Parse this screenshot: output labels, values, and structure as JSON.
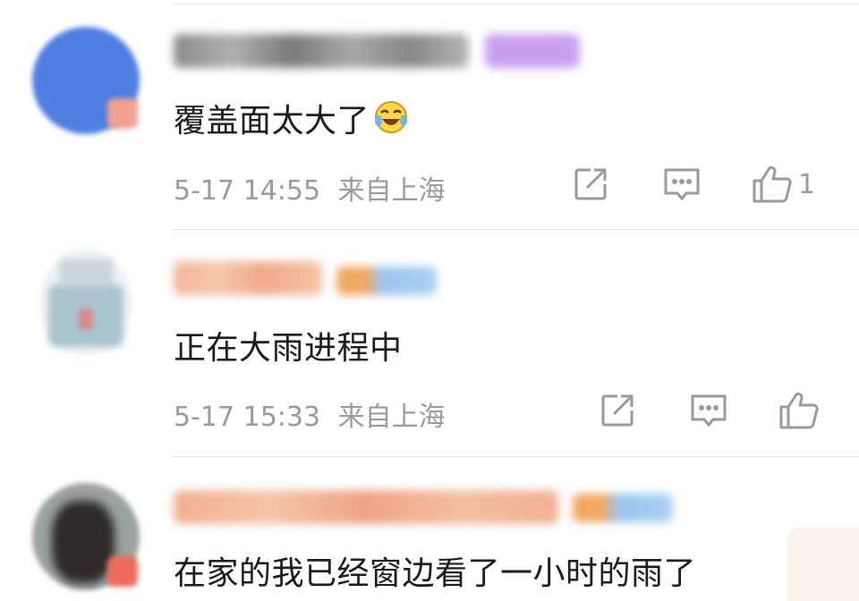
{
  "comments": [
    {
      "text": "覆盖面太大了",
      "emoji": "laughing-tears-emoji",
      "time": "5-17 14:55",
      "location": "来自上海",
      "likes": "1"
    },
    {
      "text": "正在大雨进程中",
      "time": "5-17 15:33",
      "location": "来自上海",
      "likes": ""
    },
    {
      "text": "在家的我已经窗边看了一小时的雨了"
    }
  ],
  "icons": {
    "share": "share-icon",
    "reply": "comment-icon",
    "like": "thumbs-up-icon"
  },
  "colors": {
    "text": "#1a1a1a",
    "meta": "#9a9a9a",
    "divider": "#e9e9e9"
  }
}
